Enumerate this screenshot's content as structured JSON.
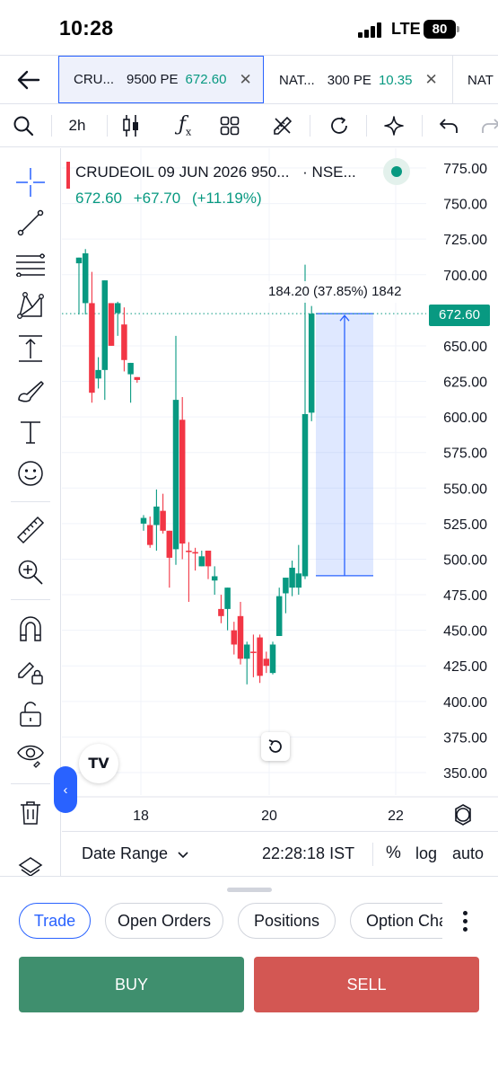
{
  "status_bar": {
    "time": "10:28",
    "network": "LTE",
    "battery": "80"
  },
  "tabs": [
    {
      "symbol": "CRU...",
      "strike": "9500 PE",
      "price": "672.60",
      "active": true
    },
    {
      "symbol": "NAT...",
      "strike": "300 PE",
      "price": "10.35",
      "active": false
    },
    {
      "symbol": "NAT",
      "strike": "",
      "price": "",
      "active": false
    }
  ],
  "toolbar": {
    "interval": "2h"
  },
  "legend": {
    "title": "CRUDEOIL 09 JUN 2026 950...",
    "exchange": "· NSE...",
    "price": "672.60",
    "change": "+67.70",
    "change_pct": "(+11.19%)"
  },
  "measure": {
    "label": "184.20 (37.85%) 1842"
  },
  "price_tag": "672.60",
  "colors": {
    "up": "#089981",
    "down": "#f23645",
    "accent": "#2962ff",
    "buy": "#3f8f6e",
    "sell": "#d35753"
  },
  "chart_data": {
    "type": "candlestick",
    "y_ticks": [
      "775.00",
      "750.00",
      "725.00",
      "700.00",
      "650.00",
      "625.00",
      "600.00",
      "575.00",
      "550.00",
      "525.00",
      "500.00",
      "475.00",
      "450.00",
      "425.00",
      "400.00",
      "375.00",
      "350.00"
    ],
    "x_ticks": [
      "18",
      "20",
      "22"
    ],
    "ylim": [
      350,
      775
    ],
    "last_price": 672.6,
    "candles": [
      {
        "open": 708,
        "high": 712,
        "low": 672,
        "close": 712
      },
      {
        "open": 680,
        "high": 718,
        "low": 672,
        "close": 715
      },
      {
        "open": 680,
        "high": 702,
        "low": 610,
        "close": 617
      },
      {
        "open": 627,
        "high": 642,
        "low": 620,
        "close": 633
      },
      {
        "open": 633,
        "high": 690,
        "low": 612,
        "close": 696
      },
      {
        "open": 680,
        "high": 677,
        "low": 650,
        "close": 650
      },
      {
        "open": 673,
        "high": 681,
        "low": 657,
        "close": 680
      },
      {
        "open": 665,
        "high": 677,
        "low": 632,
        "close": 640
      },
      {
        "open": 630,
        "high": 637,
        "low": 610,
        "close": 638
      },
      {
        "open": 628,
        "high": 626,
        "low": 624,
        "close": 626
      },
      {
        "open": 525,
        "high": 531,
        "low": 520,
        "close": 529
      },
      {
        "open": 524,
        "high": 530,
        "low": 508,
        "close": 510
      },
      {
        "open": 524,
        "high": 549,
        "low": 506,
        "close": 537
      },
      {
        "open": 534,
        "high": 546,
        "low": 518,
        "close": 520
      },
      {
        "open": 520,
        "high": 508,
        "low": 480,
        "close": 501
      },
      {
        "open": 507,
        "high": 657,
        "low": 496,
        "close": 612
      },
      {
        "open": 598,
        "high": 614,
        "low": 500,
        "close": 511
      },
      {
        "open": 506,
        "high": 512,
        "low": 470,
        "close": 505
      },
      {
        "open": 505,
        "high": 508,
        "low": 492,
        "close": 504
      },
      {
        "open": 495,
        "high": 506,
        "low": 495,
        "close": 502
      },
      {
        "open": 506,
        "high": 497,
        "low": 486,
        "close": 495
      },
      {
        "open": 485,
        "high": 495,
        "low": 475,
        "close": 488
      },
      {
        "open": 465,
        "high": 475,
        "low": 455,
        "close": 460
      },
      {
        "open": 465,
        "high": 480,
        "low": 450,
        "close": 480
      },
      {
        "open": 450,
        "high": 456,
        "low": 433,
        "close": 440
      },
      {
        "open": 460,
        "high": 470,
        "low": 426,
        "close": 430
      },
      {
        "open": 430,
        "high": 442,
        "low": 412,
        "close": 440
      },
      {
        "open": 435,
        "high": 447,
        "low": 417,
        "close": 434
      },
      {
        "open": 445,
        "high": 447,
        "low": 413,
        "close": 418
      },
      {
        "open": 430,
        "high": 435,
        "low": 420,
        "close": 425
      },
      {
        "open": 420,
        "high": 442,
        "low": 419,
        "close": 440
      },
      {
        "open": 446,
        "high": 480,
        "low": 448,
        "close": 474
      },
      {
        "open": 476,
        "high": 487,
        "low": 462,
        "close": 487
      },
      {
        "open": 480,
        "high": 499,
        "low": 474,
        "close": 494
      },
      {
        "open": 480,
        "high": 510,
        "low": 475,
        "close": 490
      },
      {
        "open": 488,
        "high": 707,
        "low": 486,
        "close": 602
      },
      {
        "open": 603,
        "high": 678,
        "low": 597,
        "close": 672.6
      }
    ],
    "measurement_range": {
      "from": 488.4,
      "to": 672.6
    }
  },
  "bottom": {
    "date_range": "Date Range",
    "clock": "22:28:18 IST",
    "pct": "%",
    "log": "log",
    "auto": "auto"
  },
  "panel_tabs": [
    "Trade",
    "Open Orders",
    "Positions",
    "Option Chain"
  ],
  "buttons": {
    "buy": "BUY",
    "sell": "SELL"
  }
}
